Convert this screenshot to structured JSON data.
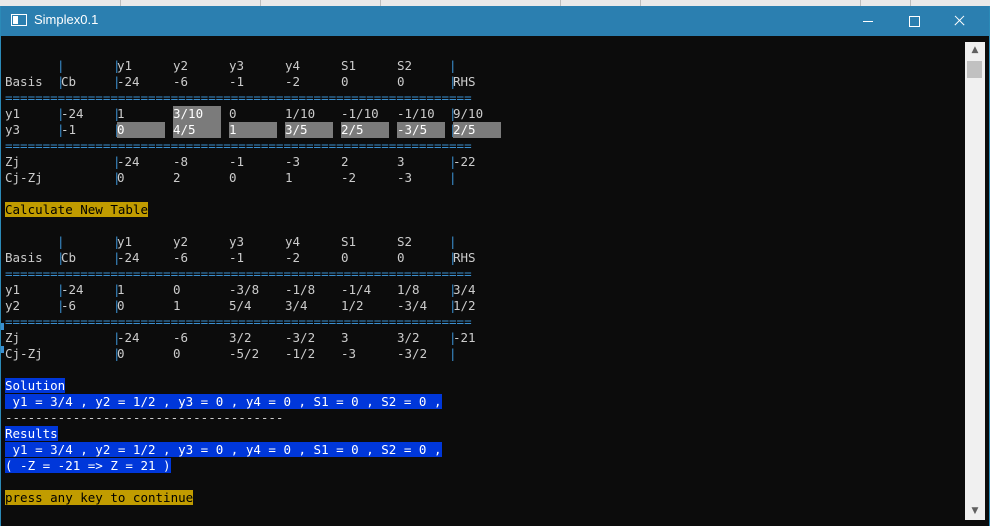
{
  "window": {
    "title": "Simplex0.1"
  },
  "tableau1": {
    "header_vars": [
      "y1",
      "y2",
      "y3",
      "y4",
      "S1",
      "S2"
    ],
    "header_label": "Basis",
    "cb_label": "Cb",
    "cj": [
      "-24",
      "-6",
      "-1",
      "-2",
      "0",
      "0"
    ],
    "rhs_label": "RHS",
    "rule": "==============================================================",
    "rows": [
      {
        "basis": "y1",
        "cb": "-24",
        "cells": [
          "1",
          "3/10",
          "0",
          "1/10",
          "-1/10",
          "-1/10"
        ],
        "rhs": "9/10",
        "highlight": [
          1
        ]
      },
      {
        "basis": "y3",
        "cb": "-1",
        "cells": [
          "0",
          "4/5",
          "1",
          "3/5",
          "2/5",
          "-3/5"
        ],
        "rhs": "2/5",
        "highlight": [
          0,
          1,
          2,
          3,
          4,
          5,
          6
        ]
      }
    ],
    "zj_label": "Zj",
    "zj": [
      "-24",
      "-8",
      "-1",
      "-3",
      "2",
      "3"
    ],
    "zj_rhs": "-22",
    "cjzj_label": "Cj-Zj",
    "cjzj": [
      "0",
      "2",
      "0",
      "1",
      "-2",
      "-3"
    ]
  },
  "calculate_prompt": "Calculate New Table",
  "tableau2": {
    "header_vars": [
      "y1",
      "y2",
      "y3",
      "y4",
      "S1",
      "S2"
    ],
    "header_label": "Basis",
    "cb_label": "Cb",
    "cj": [
      "-24",
      "-6",
      "-1",
      "-2",
      "0",
      "0"
    ],
    "rhs_label": "RHS",
    "rule": "==============================================================",
    "rows": [
      {
        "basis": "y1",
        "cb": "-24",
        "cells": [
          "1",
          "0",
          "-3/8",
          "-1/8",
          "-1/4",
          "1/8"
        ],
        "rhs": "3/4",
        "highlight": []
      },
      {
        "basis": "y2",
        "cb": "-6",
        "cells": [
          "0",
          "1",
          "5/4",
          "3/4",
          "1/2",
          "-3/4"
        ],
        "rhs": "1/2",
        "highlight": []
      }
    ],
    "zj_label": "Zj",
    "zj": [
      "-24",
      "-6",
      "3/2",
      "-3/2",
      "3",
      "3/2"
    ],
    "zj_rhs": "-21",
    "cjzj_label": "Cj-Zj",
    "cjzj": [
      "0",
      "0",
      "-5/2",
      "-1/2",
      "-3",
      "-3/2"
    ]
  },
  "solution": {
    "label": "Solution",
    "values": " y1 = 3/4 , y2 = 1/2 , y3 = 0 , y4 = 0 , S1 = 0 , S2 = 0 ,",
    "divider": "-------------------------------------"
  },
  "results": {
    "label": "Results",
    "values": " y1 = 3/4 , y2 = 1/2 , y3 = 0 , y4 = 0 , S1 = 0 , S2 = 0 ,",
    "objective": "( -Z = -21 => Z = 21 )"
  },
  "continue_prompt": "press any key to continue",
  "colors": {
    "titlebar": "#2b7fb0",
    "console_bg": "#0c0c0c",
    "highlight": "#7b7b7b",
    "prompt_yellow": "#c19c00",
    "result_blue": "#0037da",
    "separator": "#3a8fd0"
  },
  "icons": {
    "app": "console-window-icon",
    "minimize": "minimize-icon",
    "maximize": "maximize-icon",
    "close": "close-icon"
  }
}
